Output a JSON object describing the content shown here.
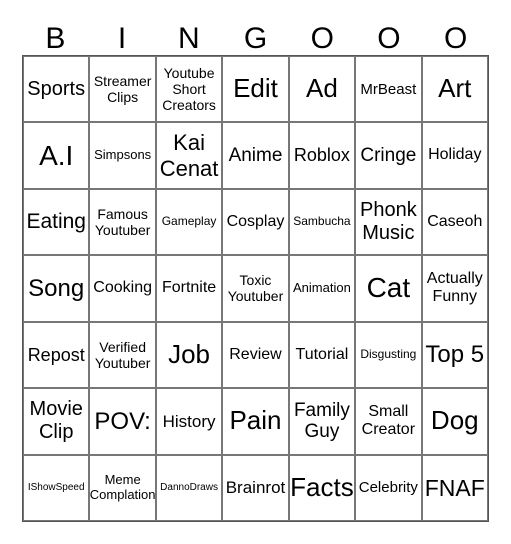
{
  "header": [
    "B",
    "I",
    "N",
    "G",
    "O",
    "O",
    "O"
  ],
  "cells": [
    [
      "Sports",
      "Streamer Clips",
      "Youtube Short Creators",
      "Edit",
      "Ad",
      "MrBeast",
      "Art"
    ],
    [
      "A.I",
      "Simpsons",
      "Kai Cenat",
      "Anime",
      "Roblox",
      "Cringe",
      "Holiday"
    ],
    [
      "Eating",
      "Famous Youtuber",
      "Gameplay",
      "Cosplay",
      "Sambucha",
      "Phonk Music",
      "Caseoh"
    ],
    [
      "Song",
      "Cooking",
      "Fortnite",
      "Toxic Youtuber",
      "Animation",
      "Cat",
      "Actually Funny"
    ],
    [
      "Repost",
      "Verified Youtuber",
      "Job",
      "Review",
      "Tutorial",
      "Disgusting",
      "Top 5"
    ],
    [
      "Movie Clip",
      "POV:",
      "History",
      "Pain",
      "Family Guy",
      "Small Creator",
      "Dog"
    ],
    [
      "IShowSpeed",
      "Meme Complation",
      "DannoDraws",
      "Brainrot",
      "Facts",
      "Celebrity",
      "FNAF"
    ]
  ]
}
